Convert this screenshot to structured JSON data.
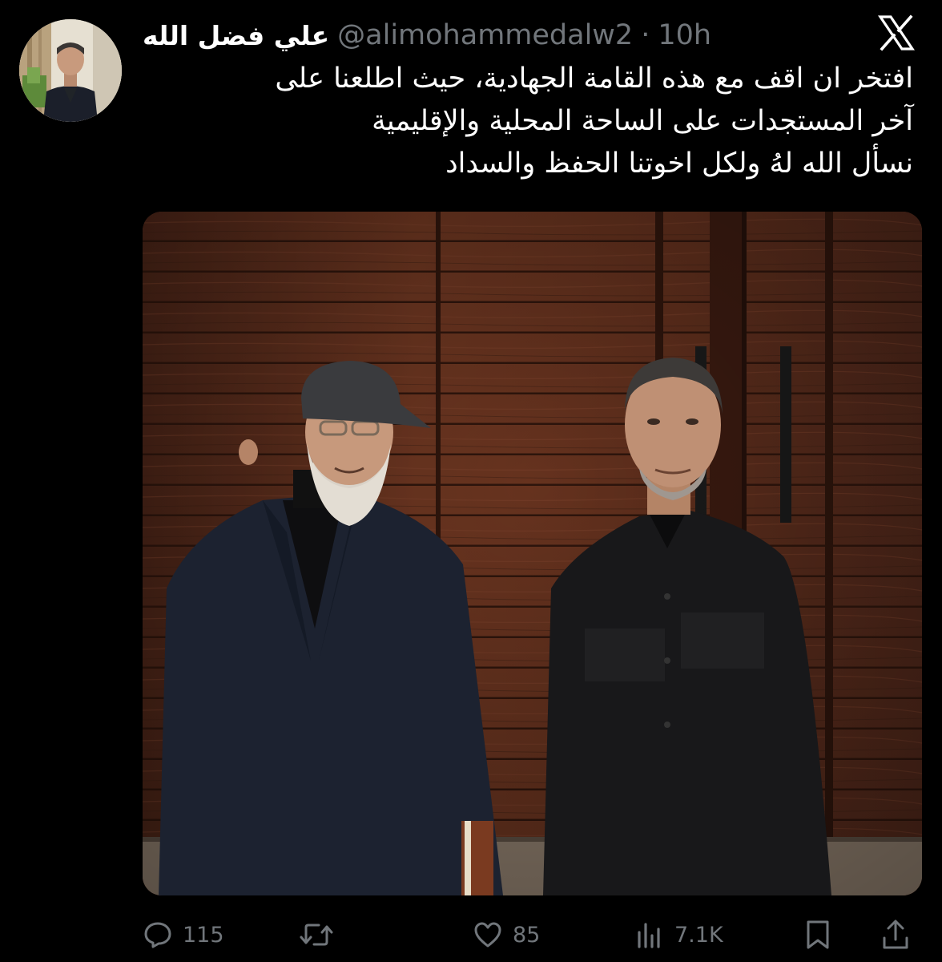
{
  "tweet": {
    "display_name": "علي فضل الله",
    "handle": "@alimohammedalw2",
    "separator": "·",
    "time": "10h",
    "text_lines": [
      "افتخر ان اقف مع هذه القامة الجهادية، حيث اطلعنا على",
      "آخر المستجدات على الساحة المحلية والإقليمية",
      "نسأل الله لهُ ولكل اخوتنا الحفظ والسداد"
    ]
  },
  "icons": {
    "brand": "x-logo-icon",
    "reply": "reply-icon",
    "retweet": "retweet-icon",
    "like": "heart-icon",
    "views": "views-icon",
    "bookmark": "bookmark-icon",
    "share": "share-icon"
  },
  "metrics": {
    "replies": "115",
    "retweets": "",
    "likes": "85",
    "views": "7.1K"
  },
  "colors": {
    "background": "#000000",
    "text_primary": "#ffffff",
    "text_secondary": "#71767b"
  }
}
